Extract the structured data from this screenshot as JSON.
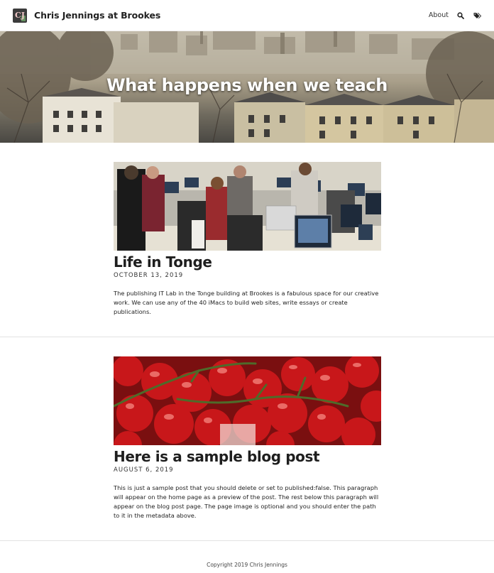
{
  "header": {
    "logo_text": "CJ",
    "site_title": "Chris Jennings at Brookes",
    "nav": {
      "about_label": "About",
      "search_icon": "search-icon",
      "tags_icon": "tags-icon"
    }
  },
  "hero": {
    "title": "What happens when we teach",
    "image": "oxford-rooftops-panorama"
  },
  "posts": [
    {
      "image": "computer-lab-students",
      "title": "Life in Tonge",
      "date": "OCTOBER 13, 2019",
      "excerpt": "The publishing IT Lab in the Tonge building at Brookes is a fabulous space for our creative work. We can use any of the 40 iMacs to build web sites, write essays or create publications."
    },
    {
      "image": "cherry-tomatoes",
      "title": "Here is a sample blog post",
      "date": "AUGUST 6, 2019",
      "excerpt": "This is just a sample post that you should delete or set to published:false. This paragraph will appear on the home page as a preview of the post. The rest below this paragraph will appear on the blog post page. The page image is optional and you should enter the path to it in the metadata above."
    }
  ],
  "footer": {
    "copyright": "Copyright 2019 Chris Jennings"
  },
  "colors": {
    "text": "#222222",
    "divider": "#e2e2e2",
    "background": "#ffffff"
  }
}
